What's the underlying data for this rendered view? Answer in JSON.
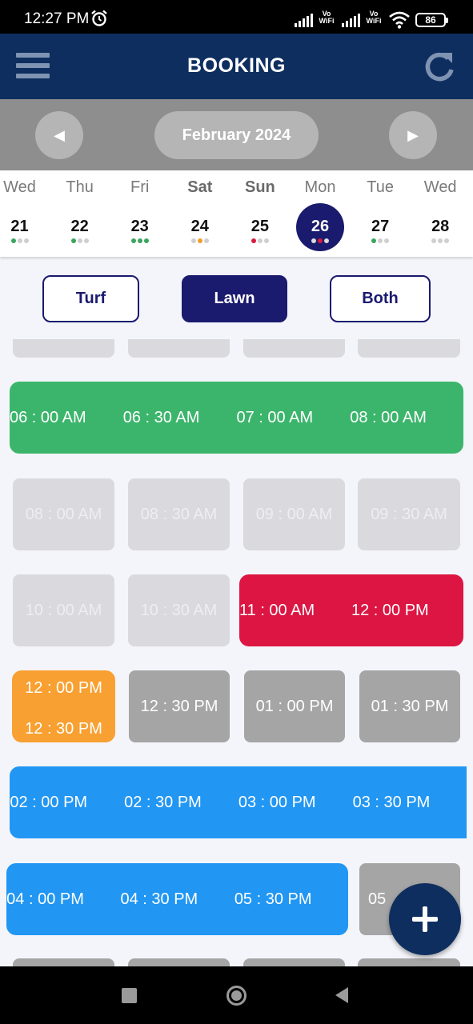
{
  "status_bar": {
    "time": "12:27 PM",
    "battery": "86",
    "network": [
      "Vo WiFi",
      "Vo WiFi"
    ]
  },
  "app_bar": {
    "title": "BOOKING",
    "menu_icon": "hamburger-menu-icon",
    "refresh_icon": "refresh-icon"
  },
  "month_nav": {
    "label": "February 2024",
    "prev": "◀",
    "next": "▶"
  },
  "days": [
    {
      "name": "Wed",
      "num": "21",
      "bold": false,
      "selected": false,
      "dots": [
        "#3aa55d",
        "#cfcfcf",
        "#cfcfcf"
      ]
    },
    {
      "name": "Thu",
      "num": "22",
      "bold": false,
      "selected": false,
      "dots": [
        "#3aa55d",
        "#cfcfcf",
        "#cfcfcf"
      ]
    },
    {
      "name": "Fri",
      "num": "23",
      "bold": false,
      "selected": false,
      "dots": [
        "#3aa55d",
        "#3aa55d",
        "#3aa55d"
      ]
    },
    {
      "name": "Sat",
      "num": "24",
      "bold": true,
      "selected": false,
      "dots": [
        "#cfcfcf",
        "#f39c2a",
        "#cfcfcf"
      ]
    },
    {
      "name": "Sun",
      "num": "25",
      "bold": true,
      "selected": false,
      "dots": [
        "#d81b40",
        "#cfcfcf",
        "#cfcfcf"
      ]
    },
    {
      "name": "Mon",
      "num": "26",
      "bold": false,
      "selected": true,
      "dots": [
        "#dcdcdc",
        "#d81b40",
        "#dcdcdc"
      ]
    },
    {
      "name": "Tue",
      "num": "27",
      "bold": false,
      "selected": false,
      "dots": [
        "#3aa55d",
        "#cfcfcf",
        "#cfcfcf"
      ]
    },
    {
      "name": "Wed",
      "num": "28",
      "bold": false,
      "selected": false,
      "dots": [
        "#cfcfcf",
        "#cfcfcf",
        "#cfcfcf"
      ]
    }
  ],
  "filters": {
    "turf": "Turf",
    "lawn": "Lawn",
    "both": "Both",
    "active": "Lawn"
  },
  "slots": {
    "green_booking": [
      "06 : 00 AM",
      "06 : 30 AM",
      "07 : 00 AM",
      "08 : 00 AM"
    ],
    "row_disabled_1": [
      "08 : 00 AM",
      "08 : 30 AM",
      "09 : 00 AM",
      "09 : 30 AM"
    ],
    "row_disabled_2": [
      "10 : 00 AM",
      "10 : 30 AM"
    ],
    "red_booking": [
      "11 : 00 AM",
      "12 : 00 PM"
    ],
    "orange_booking": [
      "12 : 00 PM",
      "12 : 30 PM"
    ],
    "gray_row": [
      "12 : 30 PM",
      "01 : 00 PM",
      "01 : 30 PM"
    ],
    "blue_booking_1": [
      "02 : 00 PM",
      "02 : 30 PM",
      "03 : 00 PM",
      "03 : 30 PM"
    ],
    "blue_booking_2": [
      "04 : 00 PM",
      "04 : 30 PM",
      "05 : 30 PM"
    ],
    "partial_gray": "05"
  },
  "colors": {
    "navy": "#0e2e5f",
    "green": "#3cb56c",
    "red": "#dc1542",
    "orange": "#f8a031",
    "blue": "#2196f3",
    "indigo": "#1a1a6e"
  },
  "fab_icon": "plus-icon"
}
